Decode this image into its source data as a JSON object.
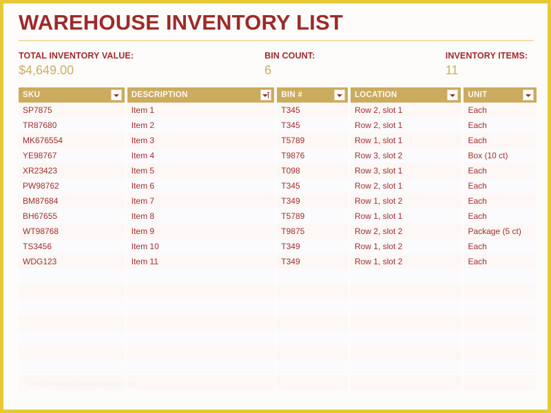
{
  "page": {
    "title": "WAREHOUSE INVENTORY LIST",
    "watermark": "www.heritagechristiancollege.com",
    "colors": {
      "border": "#e8c933",
      "title": "#9d2a2a",
      "header_band": "#cbab5e",
      "value": "#c9b063",
      "text": "#a32b2b",
      "rule": "#f5d9ab"
    }
  },
  "summary": {
    "total_value": {
      "label": "TOTAL INVENTORY VALUE:",
      "value": "$4,649.00"
    },
    "bin_count": {
      "label": "BIN COUNT:",
      "value": "6"
    },
    "inventory_items": {
      "label": "INVENTORY ITEMS:",
      "value": "11"
    }
  },
  "table": {
    "columns": [
      {
        "label": "SKU",
        "filter": "filter-icon"
      },
      {
        "label": "DESCRIPTION",
        "filter": "filter-sorted-ascending-icon"
      },
      {
        "label": "BIN #",
        "filter": "filter-icon"
      },
      {
        "label": "LOCATION",
        "filter": "filter-icon"
      },
      {
        "label": "UNIT",
        "filter": "filter-icon"
      }
    ],
    "rows": [
      [
        "SP7875",
        "Item 1",
        "T345",
        "Row 2, slot 1",
        "Each"
      ],
      [
        "TR87680",
        "Item 2",
        "T345",
        "Row 2, slot 1",
        "Each"
      ],
      [
        "MK676554",
        "Item 3",
        "T5789",
        "Row 1, slot 1",
        "Each"
      ],
      [
        "YE98767",
        "Item 4",
        "T9876",
        "Row 3, slot 2",
        "Box (10 ct)"
      ],
      [
        "XR23423",
        "Item 5",
        "T098",
        "Row 3, slot 1",
        "Each"
      ],
      [
        "PW98762",
        "Item 6",
        "T345",
        "Row 2, slot 1",
        "Each"
      ],
      [
        "BM87684",
        "Item 7",
        "T349",
        "Row 1, slot 2",
        "Each"
      ],
      [
        "BH67655",
        "Item 8",
        "T5789",
        "Row 1, slot 1",
        "Each"
      ],
      [
        "WT98768",
        "Item 9",
        "T9875",
        "Row 2, slot 2",
        "Package (5 ct)"
      ],
      [
        "TS3456",
        "Item 10",
        "T349",
        "Row 1, slot 2",
        "Each"
      ],
      [
        "WDG123",
        "Item 11",
        "T349",
        "Row 1, slot 2",
        "Each"
      ],
      [
        "",
        "",
        "",
        "",
        ""
      ],
      [
        "",
        "",
        "",
        "",
        ""
      ],
      [
        "",
        "",
        "",
        "",
        ""
      ],
      [
        "",
        "",
        "",
        "",
        ""
      ],
      [
        "",
        "",
        "",
        "",
        ""
      ],
      [
        "",
        "",
        "",
        "",
        ""
      ],
      [
        "",
        "",
        "",
        "",
        ""
      ],
      [
        "",
        "",
        "",
        "",
        ""
      ]
    ]
  }
}
